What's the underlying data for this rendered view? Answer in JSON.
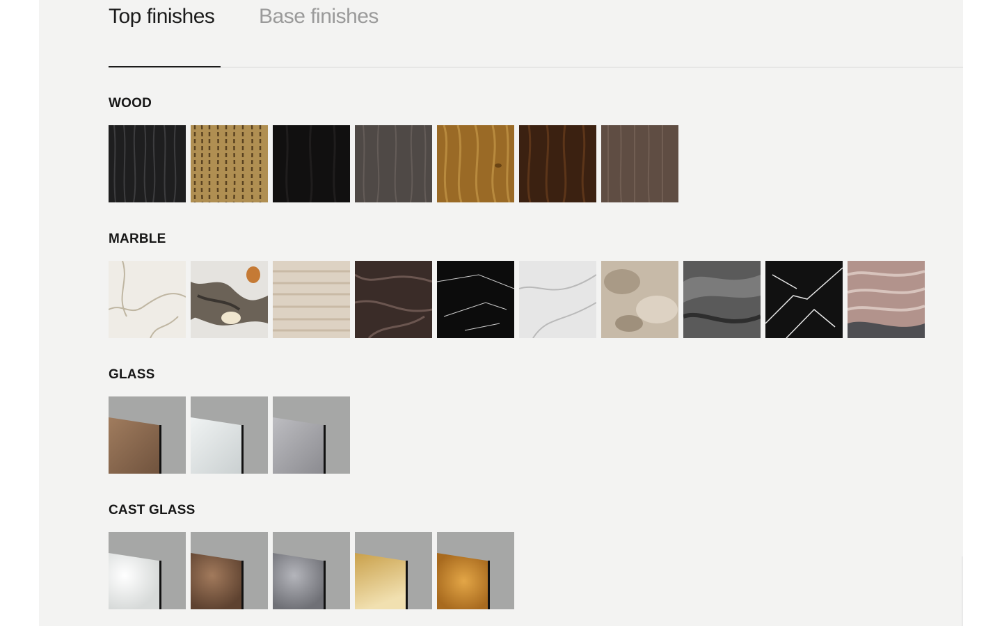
{
  "tabs": {
    "top_label": "Top finishes",
    "base_label": "Base finishes"
  },
  "sections": {
    "wood": {
      "title": "WOOD"
    },
    "marble": {
      "title": "MARBLE"
    },
    "glass": {
      "title": "GLASS"
    },
    "cast_glass": {
      "title": "CAST GLASS"
    }
  },
  "colors": {
    "panel_background": "#f3f3f2",
    "active_tab": "#1b1b1b",
    "inactive_tab": "#9a9a9a",
    "glass_backdrop": "#a6a7a6",
    "wood": [
      "#1e1e1f",
      "#b08f52",
      "#111010",
      "#4f4946",
      "#9a6a26",
      "#3b2111",
      "#5f4d43"
    ],
    "marble": [
      "#efece6",
      "#6b6257",
      "#ddd2c3",
      "#3a2c28",
      "#0c0c0c",
      "#e6e6e6",
      "#c7baa8",
      "#5a5a5a",
      "#111111",
      "#b2938c"
    ],
    "glass": [
      "#8a6b52",
      "#dfe3e3",
      "#a7a7ab"
    ],
    "cast_glass": [
      "#e9ebea",
      "#7d5a41",
      "#8f9096",
      "#d8b563",
      "#c98a30"
    ]
  }
}
